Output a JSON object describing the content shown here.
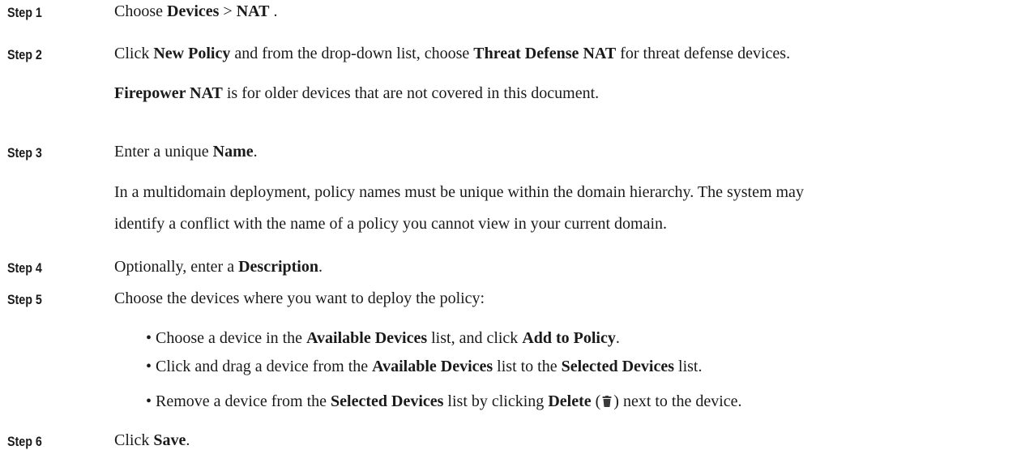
{
  "steps": [
    {
      "label": "Step 1",
      "parts": [
        "Choose ",
        "Devices",
        " > ",
        "NAT",
        " ."
      ]
    },
    {
      "label": "Step 2",
      "parts": [
        "Click ",
        "New Policy",
        " and from the drop-down list, choose ",
        "Threat Defense NAT",
        " for threat defense devices."
      ],
      "note": [
        "Firepower NAT",
        " is for older devices that are not covered in this document."
      ]
    },
    {
      "label": "Step 3",
      "parts": [
        "Enter a unique ",
        "Name",
        "."
      ],
      "note_lines": [
        "In a multidomain deployment, policy names must be unique within the domain hierarchy. The system may",
        "identify a conflict with the name of a policy you cannot view in your current domain."
      ]
    },
    {
      "label": "Step 4",
      "parts": [
        "Optionally, enter a ",
        "Description",
        "."
      ]
    },
    {
      "label": "Step 5",
      "text": "Choose the devices where you want to deploy the policy:",
      "bullets": [
        [
          "• Choose a device in the ",
          "Available Devices",
          " list, and click ",
          "Add to Policy",
          "."
        ],
        [
          "• Click and drag a device from the ",
          "Available Devices",
          " list to the ",
          "Selected Devices",
          " list."
        ],
        [
          "• Remove a device from the ",
          "Selected Devices",
          " list by clicking ",
          "Delete",
          " (",
          ") next to the device."
        ]
      ],
      "icon": "trash-icon"
    },
    {
      "label": "Step 6",
      "parts": [
        "Click ",
        "Save",
        "."
      ]
    }
  ]
}
